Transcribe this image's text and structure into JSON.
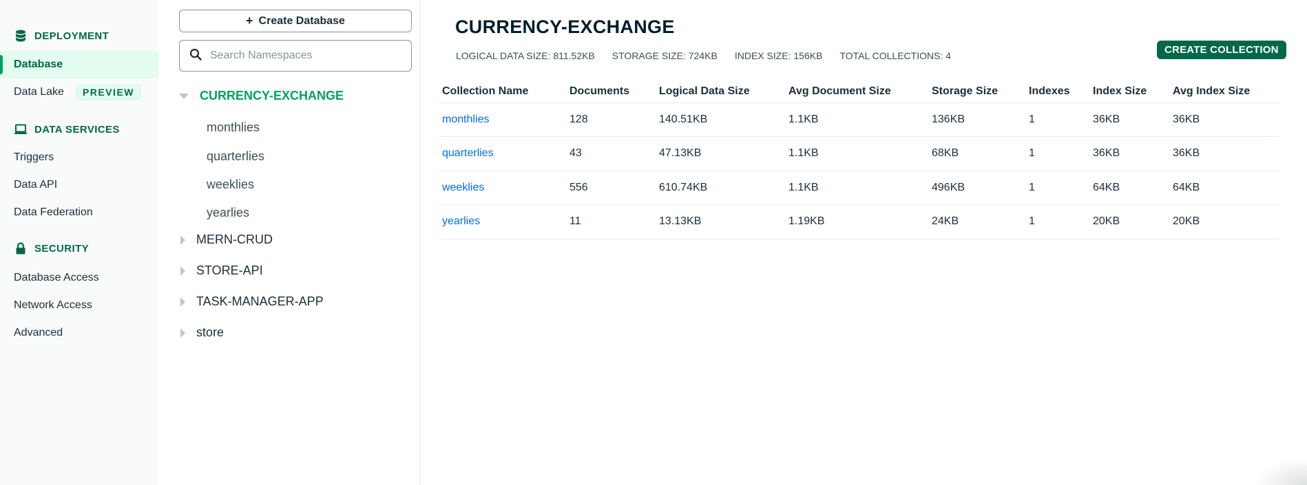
{
  "nav": {
    "deployment": {
      "header": "DEPLOYMENT",
      "icon": "database-icon"
    },
    "items_deployment": [
      {
        "label": "Database",
        "active": true
      },
      {
        "label": "Data Lake",
        "badge": "PREVIEW"
      }
    ],
    "data_services": {
      "header": "DATA SERVICES",
      "icon": "laptop-icon"
    },
    "items_services": [
      {
        "label": "Triggers"
      },
      {
        "label": "Data API"
      },
      {
        "label": "Data Federation"
      }
    ],
    "security": {
      "header": "SECURITY",
      "icon": "lock-icon"
    },
    "items_security": [
      {
        "label": "Database Access"
      },
      {
        "label": "Network Access"
      },
      {
        "label": "Advanced"
      }
    ]
  },
  "namespaces": {
    "create_button": "Create Database",
    "search_placeholder": "Search Namespaces",
    "databases": [
      {
        "name": "CURRENCY-EXCHANGE",
        "open": true,
        "collections": [
          "monthlies",
          "quarterlies",
          "weeklies",
          "yearlies"
        ]
      },
      {
        "name": "MERN-CRUD"
      },
      {
        "name": "STORE-API"
      },
      {
        "name": "TASK-MANAGER-APP"
      },
      {
        "name": "store"
      }
    ]
  },
  "main": {
    "title": "CURRENCY-EXCHANGE",
    "stats": {
      "logical": "LOGICAL DATA SIZE: 811.52KB",
      "storage": "STORAGE SIZE: 724KB",
      "index": "INDEX SIZE: 156KB",
      "collections": "TOTAL COLLECTIONS: 4"
    },
    "create_collection": "CREATE COLLECTION",
    "columns": [
      "Collection Name",
      "Documents",
      "Logical Data Size",
      "Avg Document Size",
      "Storage Size",
      "Indexes",
      "Index Size",
      "Avg Index Size"
    ],
    "rows": [
      [
        "monthlies",
        "128",
        "140.51KB",
        "1.1KB",
        "136KB",
        "1",
        "36KB",
        "36KB"
      ],
      [
        "quarterlies",
        "43",
        "47.13KB",
        "1.1KB",
        "68KB",
        "1",
        "36KB",
        "36KB"
      ],
      [
        "weeklies",
        "556",
        "610.74KB",
        "1.1KB",
        "496KB",
        "1",
        "64KB",
        "64KB"
      ],
      [
        "yearlies",
        "11",
        "13.13KB",
        "1.19KB",
        "24KB",
        "1",
        "20KB",
        "20KB"
      ]
    ]
  },
  "colors": {
    "brand_green": "#00684a",
    "accent_green": "#00a35c",
    "link_blue": "#016bf8"
  }
}
